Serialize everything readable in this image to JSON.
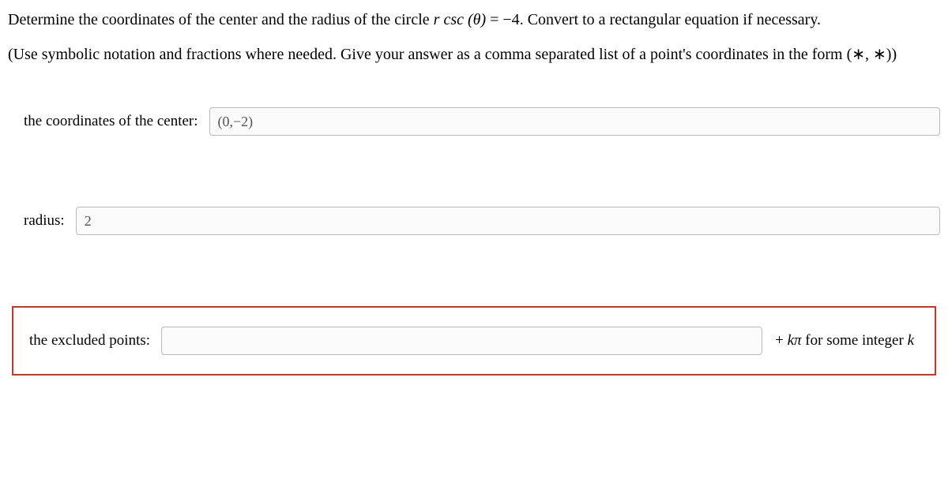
{
  "question": {
    "main_text_before": "Determine the coordinates of the center and the radius of the circle ",
    "equation_lhs": "r csc (θ)",
    "equals": " = ",
    "equation_rhs": "−4",
    "main_text_after": ". Convert to a rectangular equation if necessary.",
    "instruction": "(Use symbolic notation and fractions where needed. Give your answer as a comma separated list of a point's coordinates in the form (∗, ∗))"
  },
  "answers": {
    "center": {
      "label": "the coordinates of the center:",
      "value": "(0,−2)"
    },
    "radius": {
      "label": "radius:",
      "value": "2"
    },
    "excluded": {
      "label": "the excluded points:",
      "value": "",
      "suffix_prefix": "+ ",
      "suffix_k": "k",
      "suffix_pi": "π",
      "suffix_text": " for some integer ",
      "suffix_k2": "k"
    }
  }
}
